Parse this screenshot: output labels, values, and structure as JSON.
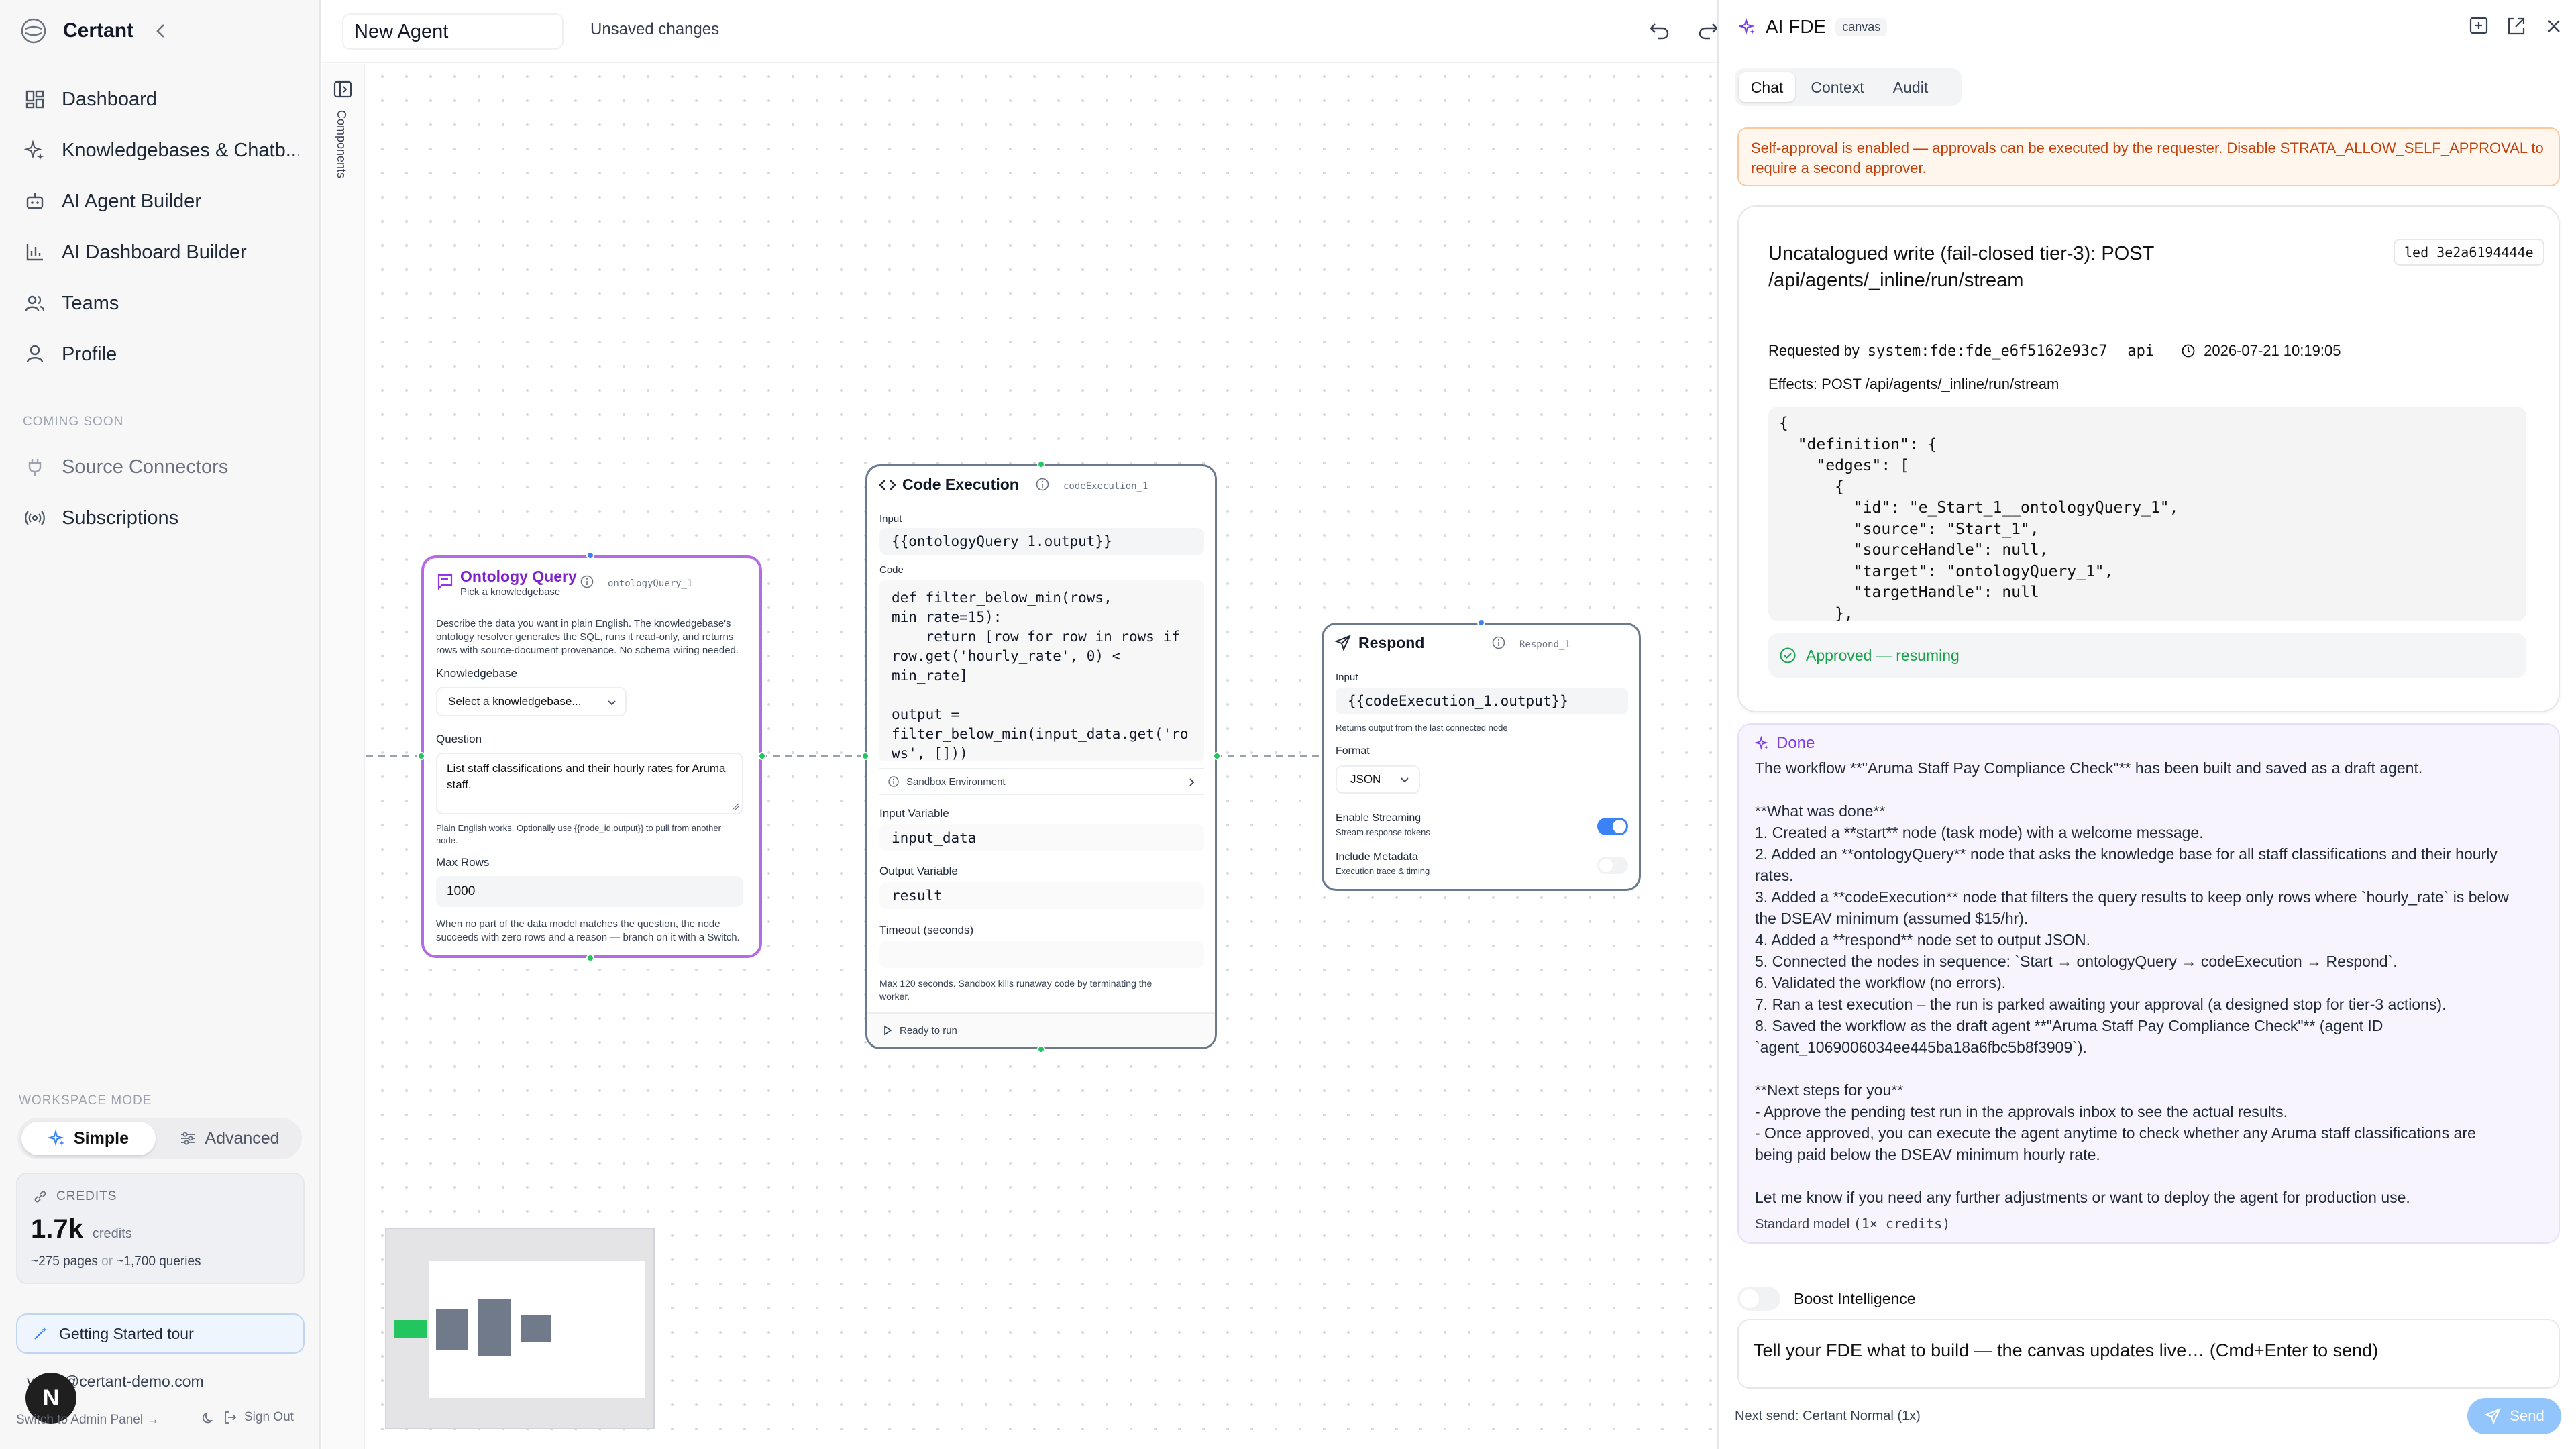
{
  "sidebar": {
    "brand": "Certant",
    "nav": [
      {
        "label": "Dashboard"
      },
      {
        "label": "Knowledgebases & Chatb..."
      },
      {
        "label": "AI Agent Builder"
      },
      {
        "label": "AI Dashboard Builder"
      },
      {
        "label": "Teams"
      },
      {
        "label": "Profile"
      }
    ],
    "coming_soon_label": "COMING SOON",
    "coming_soon": [
      {
        "label": "Source Connectors"
      },
      {
        "label": "Subscriptions"
      }
    ],
    "workspace_mode_label": "WORKSPACE MODE",
    "mode_simple": "Simple",
    "mode_advanced": "Advanced",
    "credits_label": "CREDITS",
    "credits_value": "1.7k",
    "credits_unit": "credits",
    "credits_pages": "~275 pages",
    "credits_or": "or",
    "credits_queries": "~1,700 queries",
    "tour": "Getting Started tour",
    "user_email": "verify@certant-demo.com",
    "avatar_initial": "N",
    "admin_link": "Switch to Admin Panel →",
    "sign_out": "Sign Out"
  },
  "canvas": {
    "agent_name": "New Agent",
    "status": "Unsaved changes",
    "rail_label": "Components",
    "ontology": {
      "title": "Ontology Query",
      "subtitle": "Pick a knowledgebase",
      "id": "ontologyQuery_1",
      "desc_1": "Describe the data you want in plain English. The knowledgebase's",
      "desc_2": "ontology resolver generates the SQL, runs it read-only, and returns",
      "desc_3": "rows with source-document provenance. No schema wiring needed.",
      "kb_label": "Knowledgebase",
      "kb_placeholder": "Select a knowledgebase...",
      "question_label": "Question",
      "question_line1": "List staff classifications and their hourly rates for Aruma",
      "question_line2": "staff.",
      "hint_1": "Plain English works. Optionally use {{node_id.output}} to pull from another",
      "hint_2": "node.",
      "maxrows_label": "Max Rows",
      "maxrows_value": "1000",
      "footer_1": "When no part of the data model matches the question, the node",
      "footer_2": "succeeds with zero rows and a reason — branch on it with a Switch."
    },
    "code": {
      "title": "Code Execution",
      "id": "codeExecution_1",
      "input_label": "Input",
      "input_value": "{{ontologyQuery_1.output}}",
      "code_label": "Code",
      "code_lines": [
        "def filter_below_min(rows,",
        "min_rate=15):",
        "    return [row for row in rows if",
        "row.get('hourly_rate', 0) <",
        "min_rate]",
        "",
        "output =",
        "filter_below_min(input_data.get('ro",
        "ws', []))"
      ],
      "sandbox": "Sandbox Environment",
      "input_var_label": "Input Variable",
      "input_var_value": "input_data",
      "output_var_label": "Output Variable",
      "output_var_value": "result",
      "timeout_label": "Timeout (seconds)",
      "timeout_hint_1": "Max 120 seconds. Sandbox kills runaway code by terminating the",
      "timeout_hint_2": "worker.",
      "ready": "Ready to run"
    },
    "respond": {
      "title": "Respond",
      "id": "Respond_1",
      "input_label": "Input",
      "input_value": "{{codeExecution_1.output}}",
      "input_hint": "Returns output from the last connected node",
      "format_label": "Format",
      "format_value": "JSON",
      "streaming_label": "Enable Streaming",
      "streaming_sub": "Stream response tokens",
      "metadata_label": "Include Metadata",
      "metadata_sub": "Execution trace & timing"
    }
  },
  "panel": {
    "title": "AI FDE",
    "badge": "canvas",
    "tabs": [
      "Chat",
      "Context",
      "Audit"
    ],
    "active_tab": "Chat",
    "warning_1": "Self-approval is enabled — approvals can be executed by the requester. Disable STRATA_ALLOW_SELF_APPROVAL to",
    "warning_2": "require a second approver.",
    "approval": {
      "title_1": "Uncatalogued write (fail-closed tier-3): POST",
      "title_2": "/api/agents/_inline/run/stream",
      "ledger_id": "led_3e2a6194444e",
      "requested_by_label": "Requested by",
      "requester": "system:fde:fde_e6f5162e93c7",
      "channel": "api",
      "timestamp": "2026-07-21 10:19:05",
      "effects": "Effects: POST /api/agents/_inline/run/stream",
      "json_lines": [
        "{",
        "  \"definition\": {",
        "    \"edges\": [",
        "      {",
        "        \"id\": \"e_Start_1__ontologyQuery_1\",",
        "        \"source\": \"Start_1\",",
        "        \"sourceHandle\": null,",
        "        \"target\": \"ontologyQuery_1\",",
        "        \"targetHandle\": null",
        "      },"
      ],
      "status": "Approved — resuming"
    },
    "done": {
      "label": "Done",
      "lines": [
        "The workflow **\"Aruma Staff Pay Compliance Check\"** has been built and saved as a draft agent.",
        "",
        "**What was done**",
        "1. Created a **start** node (task mode) with a welcome message.",
        "2. Added an **ontologyQuery** node that asks the knowledge base for all staff classifications and their hourly",
        "rates.",
        "3. Added a **codeExecution** node that filters the query results to keep only rows where `hourly_rate` is below",
        "the DSEAV minimum (assumed $15/hr).",
        "4. Added a **respond** node set to output JSON.",
        "5. Connected the nodes in sequence: `Start → ontologyQuery → codeExecution → Respond`.",
        "6. Validated the workflow (no errors).",
        "7. Ran a test execution – the run is parked awaiting your approval (a designed stop for tier-3 actions).",
        "8. Saved the workflow as the draft agent **\"Aruma Staff Pay Compliance Check\"** (agent ID",
        "`agent_1069006034ee445ba18a6fbc5b8f3909`).",
        "",
        "**Next steps for you**",
        "- Approve the pending test run in the approvals inbox to see the actual results.",
        "- Once approved, you can execute the agent anytime to check whether any Aruma staff classifications are",
        "being paid below the DSEAV minimum hourly rate.",
        "",
        "Let me know if you need any further adjustments or want to deploy the agent for production use."
      ],
      "model_note": "Standard model",
      "model_credits": "(1× credits)"
    },
    "boost": "Boost Intelligence",
    "input_placeholder": "Tell your FDE what to build — the canvas updates live…  (Cmd+Enter to send)",
    "next_send": "Next send: Certant Normal (1x)",
    "send": "Send"
  },
  "colors": {
    "accent": "#3b82f6",
    "ontology_border": "#b56be6",
    "warning_text": "#c2410c",
    "approved": "#16a34a",
    "done_purple": "#7c3aed"
  }
}
